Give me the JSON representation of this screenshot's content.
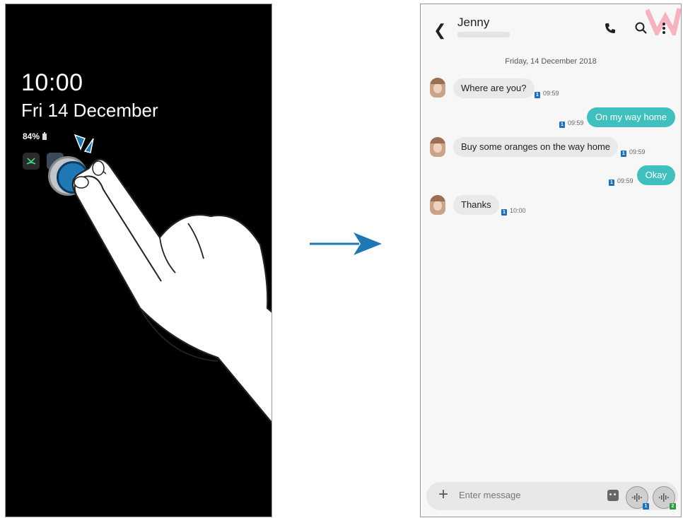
{
  "lock_screen": {
    "time": "10:00",
    "date": "Fri 14 December",
    "battery": "84%",
    "notification_icons": [
      "missed-call-icon",
      "message-icon"
    ]
  },
  "messages_app": {
    "contact_name": "Jenny",
    "header_icons": [
      "back-icon",
      "phone-icon",
      "search-icon",
      "more-icon"
    ],
    "date_separator": "Friday, 14 December 2018",
    "messages": [
      {
        "direction": "in",
        "text": "Where are you?",
        "sim": "1",
        "time": "09:59"
      },
      {
        "direction": "out",
        "text": "On my way home",
        "sim": "1",
        "time": "09:59"
      },
      {
        "direction": "in",
        "text": "Buy some oranges on the way home",
        "sim": "1",
        "time": "09:59"
      },
      {
        "direction": "out",
        "text": "Okay",
        "sim": "1",
        "time": "09:59"
      },
      {
        "direction": "in",
        "text": "Thanks",
        "sim": "1",
        "time": "10:00"
      }
    ],
    "composer": {
      "placeholder": "Enter message",
      "voice_sim_1": "1",
      "voice_sim_2": "2"
    }
  },
  "colors": {
    "incoming_bubble": "#e9e9e9",
    "outgoing_bubble": "#3fbfbd",
    "arrow": "#1f77b4",
    "sim_1": "#1d6fb8",
    "sim_2": "#2c9a3d"
  }
}
